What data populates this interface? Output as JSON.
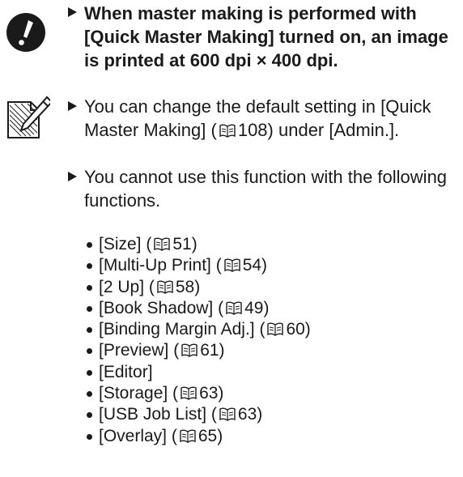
{
  "warning": {
    "icon": "exclamation-warning-icon",
    "text": "When master making is performed with [Quick Master Making] turned on, an image is printed at 600 dpi × 400 dpi."
  },
  "notes": {
    "icon": "memo-pencil-icon",
    "note1": {
      "before": "You can change the default setting in [Quick Master Making] (",
      "page": "108",
      "after": ") under [Admin.]."
    },
    "note2": "You cannot use this function with the following functions."
  },
  "functions": [
    {
      "label": "[Size] (",
      "page": "51",
      "tail": ")"
    },
    {
      "label": "[Multi-Up Print] (",
      "page": "54",
      "tail": ")"
    },
    {
      "label": "[2 Up] (",
      "page": "58",
      "tail": ")"
    },
    {
      "label": "[Book Shadow] (",
      "page": "49",
      "tail": ")"
    },
    {
      "label": "[Binding Margin Adj.] (",
      "page": "60",
      "tail": ")"
    },
    {
      "label": "[Preview] (",
      "page": "61",
      "tail": ")"
    },
    {
      "label": "[Editor]",
      "page": null,
      "tail": ""
    },
    {
      "label": "[Storage] (",
      "page": "63",
      "tail": ")"
    },
    {
      "label": "[USB Job List] (",
      "page": "63",
      "tail": ")"
    },
    {
      "label": "[Overlay] (",
      "page": "65",
      "tail": ")"
    }
  ]
}
